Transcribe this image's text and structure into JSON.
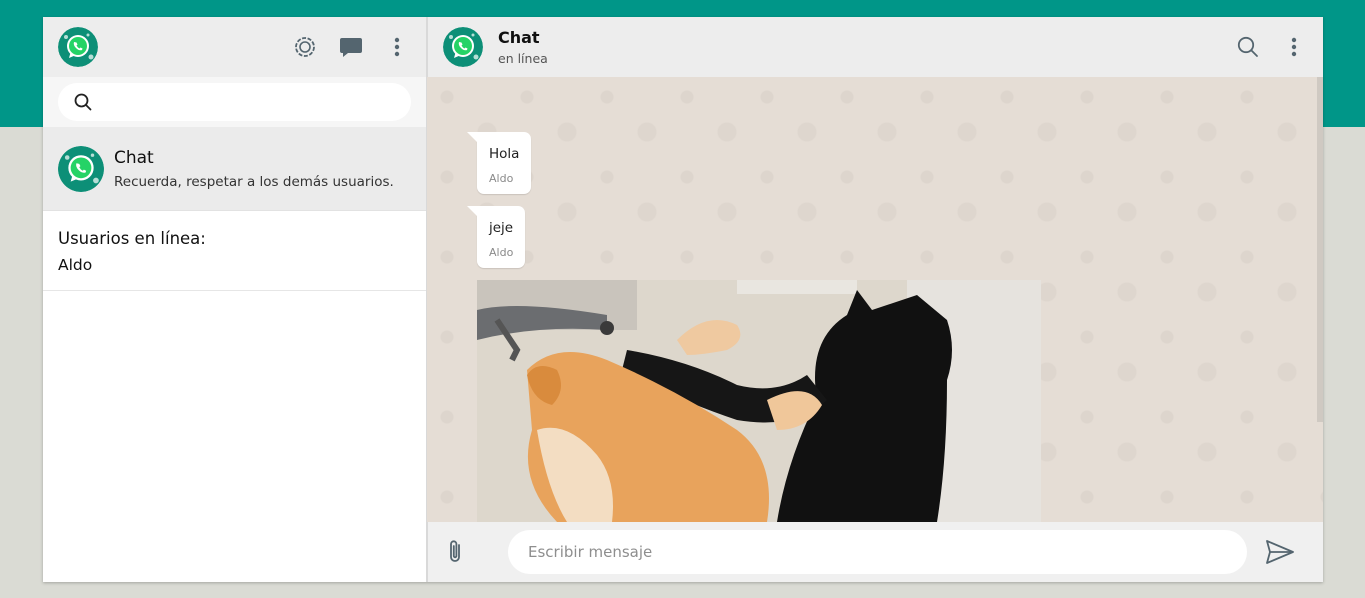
{
  "colors": {
    "brand": "#009688",
    "background": "#dadbd4",
    "chat_wallpaper": "#e5ddd5",
    "header_gray": "#ededed",
    "whatsapp_green": "#25d366"
  },
  "sidebar": {
    "header": {
      "avatar_icon": "whatsapp-logo-icon",
      "actions": [
        "status-icon",
        "new-chat-icon",
        "menu-dots-icon"
      ]
    },
    "search": {
      "placeholder": ""
    },
    "chats": [
      {
        "name": "Chat",
        "preview": "Recuerda, respetar a los demás usuarios.",
        "avatar_icon": "whatsapp-logo-icon"
      }
    ],
    "online": {
      "title": "Usuarios en línea:",
      "users": [
        "Aldo"
      ]
    }
  },
  "main": {
    "header": {
      "title": "Chat",
      "status": "en línea",
      "actions": [
        "search-icon",
        "menu-dots-icon"
      ]
    },
    "messages": [
      {
        "text": "Hola",
        "author": "Aldo"
      },
      {
        "text": "jeje",
        "author": "Aldo"
      },
      {
        "type": "image",
        "subject": "cats-fighting-gif"
      }
    ],
    "composer": {
      "placeholder": "Escribir mensaje",
      "attach_icon": "paperclip-icon",
      "send_icon": "send-icon"
    }
  }
}
